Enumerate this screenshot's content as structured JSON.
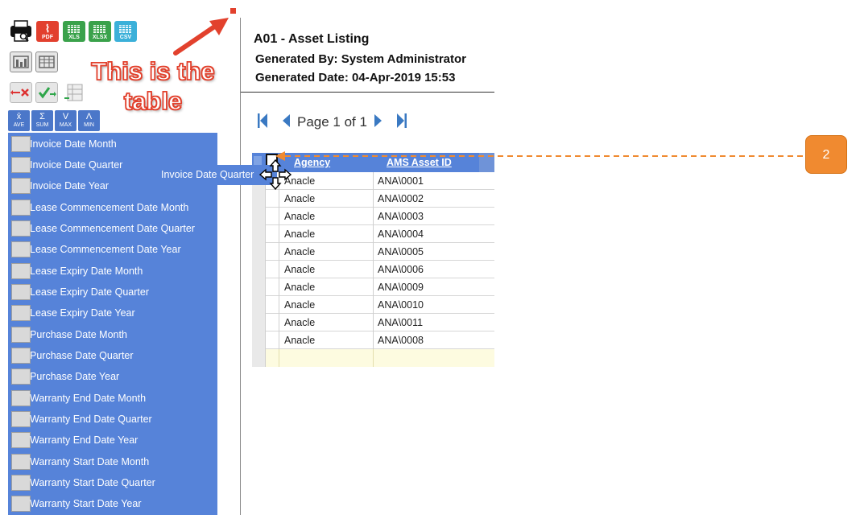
{
  "toolbar": {
    "export_icons": [
      {
        "name": "print-preview-icon"
      },
      {
        "name": "pdf-icon",
        "label": "PDF",
        "color": "#e2402e"
      },
      {
        "name": "xls-icon",
        "label": "XLS",
        "color": "#3aa24b"
      },
      {
        "name": "xlsx-icon",
        "label": "XLSX",
        "color": "#3aa24b"
      },
      {
        "name": "csv-icon",
        "label": "CSV",
        "color": "#3bb0d9"
      }
    ],
    "aggregates": [
      {
        "symbol": "x̄",
        "label": "AVE"
      },
      {
        "symbol": "Σ",
        "label": "SUM"
      },
      {
        "symbol": "V",
        "label": "MAX"
      },
      {
        "symbol": "Λ",
        "label": "MIN"
      }
    ]
  },
  "annotation": {
    "line1": "This is the",
    "line2": "table",
    "color": "#e2412d"
  },
  "fields": [
    "Invoice Date Month",
    "Invoice Date Quarter",
    "Invoice Date Year",
    "Lease Commencement Date Month",
    "Lease Commencement Date Quarter",
    "Lease Commencement Date Year",
    "Lease Expiry Date Month",
    "Lease Expiry Date Quarter",
    "Lease Expiry Date Year",
    "Purchase Date Month",
    "Purchase Date Quarter",
    "Purchase Date Year",
    "Warranty End Date Month",
    "Warranty End Date Quarter",
    "Warranty End Date Year",
    "Warranty Start Date Month",
    "Warranty Start Date Quarter",
    "Warranty Start Date Year"
  ],
  "drag_ghost": "Invoice Date Quarter",
  "report": {
    "title": "A01 - Asset Listing",
    "generated_by": "Generated By: System Administrator",
    "generated_date": "Generated Date: 04-Apr-2019 15:53",
    "pager": "Page 1 of 1"
  },
  "table": {
    "headers": [
      "Agency",
      "AMS Asset ID"
    ],
    "rows": [
      [
        "Anacle",
        "ANA\\0001"
      ],
      [
        "Anacle",
        "ANA\\0002"
      ],
      [
        "Anacle",
        "ANA\\0003"
      ],
      [
        "Anacle",
        "ANA\\0004"
      ],
      [
        "Anacle",
        "ANA\\0005"
      ],
      [
        "Anacle",
        "ANA\\0006"
      ],
      [
        "Anacle",
        "ANA\\0009"
      ],
      [
        "Anacle",
        "ANA\\0010"
      ],
      [
        "Anacle",
        "ANA\\0011"
      ],
      [
        "Anacle",
        "ANA\\0008"
      ]
    ]
  },
  "callout": {
    "number": "2",
    "color": "#f08a30"
  }
}
